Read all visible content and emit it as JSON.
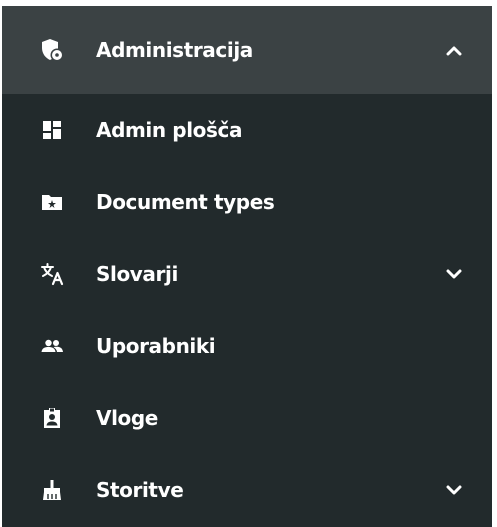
{
  "menu": {
    "header": {
      "label": "Administracija",
      "icon": "admin-shield-icon",
      "expanded": true
    },
    "items": [
      {
        "label": "Admin plošča",
        "icon": "dashboard-icon"
      },
      {
        "label": "Document types",
        "icon": "folder-icon"
      },
      {
        "label": "Slovarji",
        "icon": "translate-icon",
        "expandable": true
      },
      {
        "label": "Uporabniki",
        "icon": "users-icon"
      },
      {
        "label": "Vloge",
        "icon": "badge-icon"
      },
      {
        "label": "Storitve",
        "icon": "broom-icon",
        "expandable": true
      }
    ]
  },
  "colors": {
    "background": "#222a2c",
    "header_background": "#3b4244",
    "text": "#ffffff"
  }
}
